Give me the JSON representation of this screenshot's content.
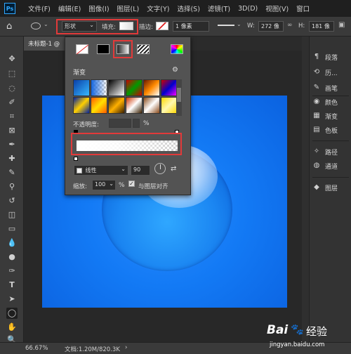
{
  "app": {
    "logo": "Ps"
  },
  "menu": [
    "文件(F)",
    "编辑(E)",
    "图像(I)",
    "图层(L)",
    "文字(Y)",
    "选择(S)",
    "滤镜(T)",
    "3D(D)",
    "视图(V)",
    "窗口"
  ],
  "options": {
    "mode_value": "形状",
    "fill_label": "填充:",
    "stroke_label": "描边:",
    "stroke_width": "1 像素",
    "w_label": "W:",
    "w_value": "272 像",
    "h_label": "H:",
    "h_value": "181 像"
  },
  "document": {
    "tab_title": "未标题-1 @"
  },
  "fill_popup": {
    "gradient_section": "渐变",
    "opacity_label": "不透明度:",
    "opacity_unit": "%",
    "style_value": "线性",
    "angle_value": "90",
    "scale_label": "缩放:",
    "scale_value": "100",
    "scale_unit": "%",
    "align_label": "与图层对齐",
    "align_checked": true
  },
  "panels": [
    {
      "icon": "paragraph-icon",
      "glyph": "¶",
      "label": "段落"
    },
    {
      "icon": "history-icon",
      "glyph": "⟲",
      "label": "历..."
    },
    {
      "icon": "brush-icon",
      "glyph": "✎",
      "label": "画笔"
    },
    {
      "icon": "color-icon",
      "glyph": "◉",
      "label": "颜色"
    },
    {
      "icon": "swatches-icon",
      "glyph": "▦",
      "label": "渐变"
    },
    {
      "icon": "swatch-grid-icon",
      "glyph": "▤",
      "label": "色板"
    },
    {
      "icon": "paths-icon",
      "glyph": "✧",
      "label": "路径"
    },
    {
      "icon": "channels-icon",
      "glyph": "◍",
      "label": "通道"
    },
    {
      "icon": "layers-icon",
      "glyph": "◆",
      "label": "图层"
    }
  ],
  "status": {
    "zoom": "66.67%",
    "doc_info": "文档:1.20M/820.3K"
  },
  "watermark": {
    "brand": "Bai",
    "brand_suffix": "经验",
    "url": "jingyan.baidu.com"
  },
  "colors": {
    "accent_red": "#e23a3a",
    "canvas_blue": "#137af5",
    "panel_bg": "#535353"
  }
}
